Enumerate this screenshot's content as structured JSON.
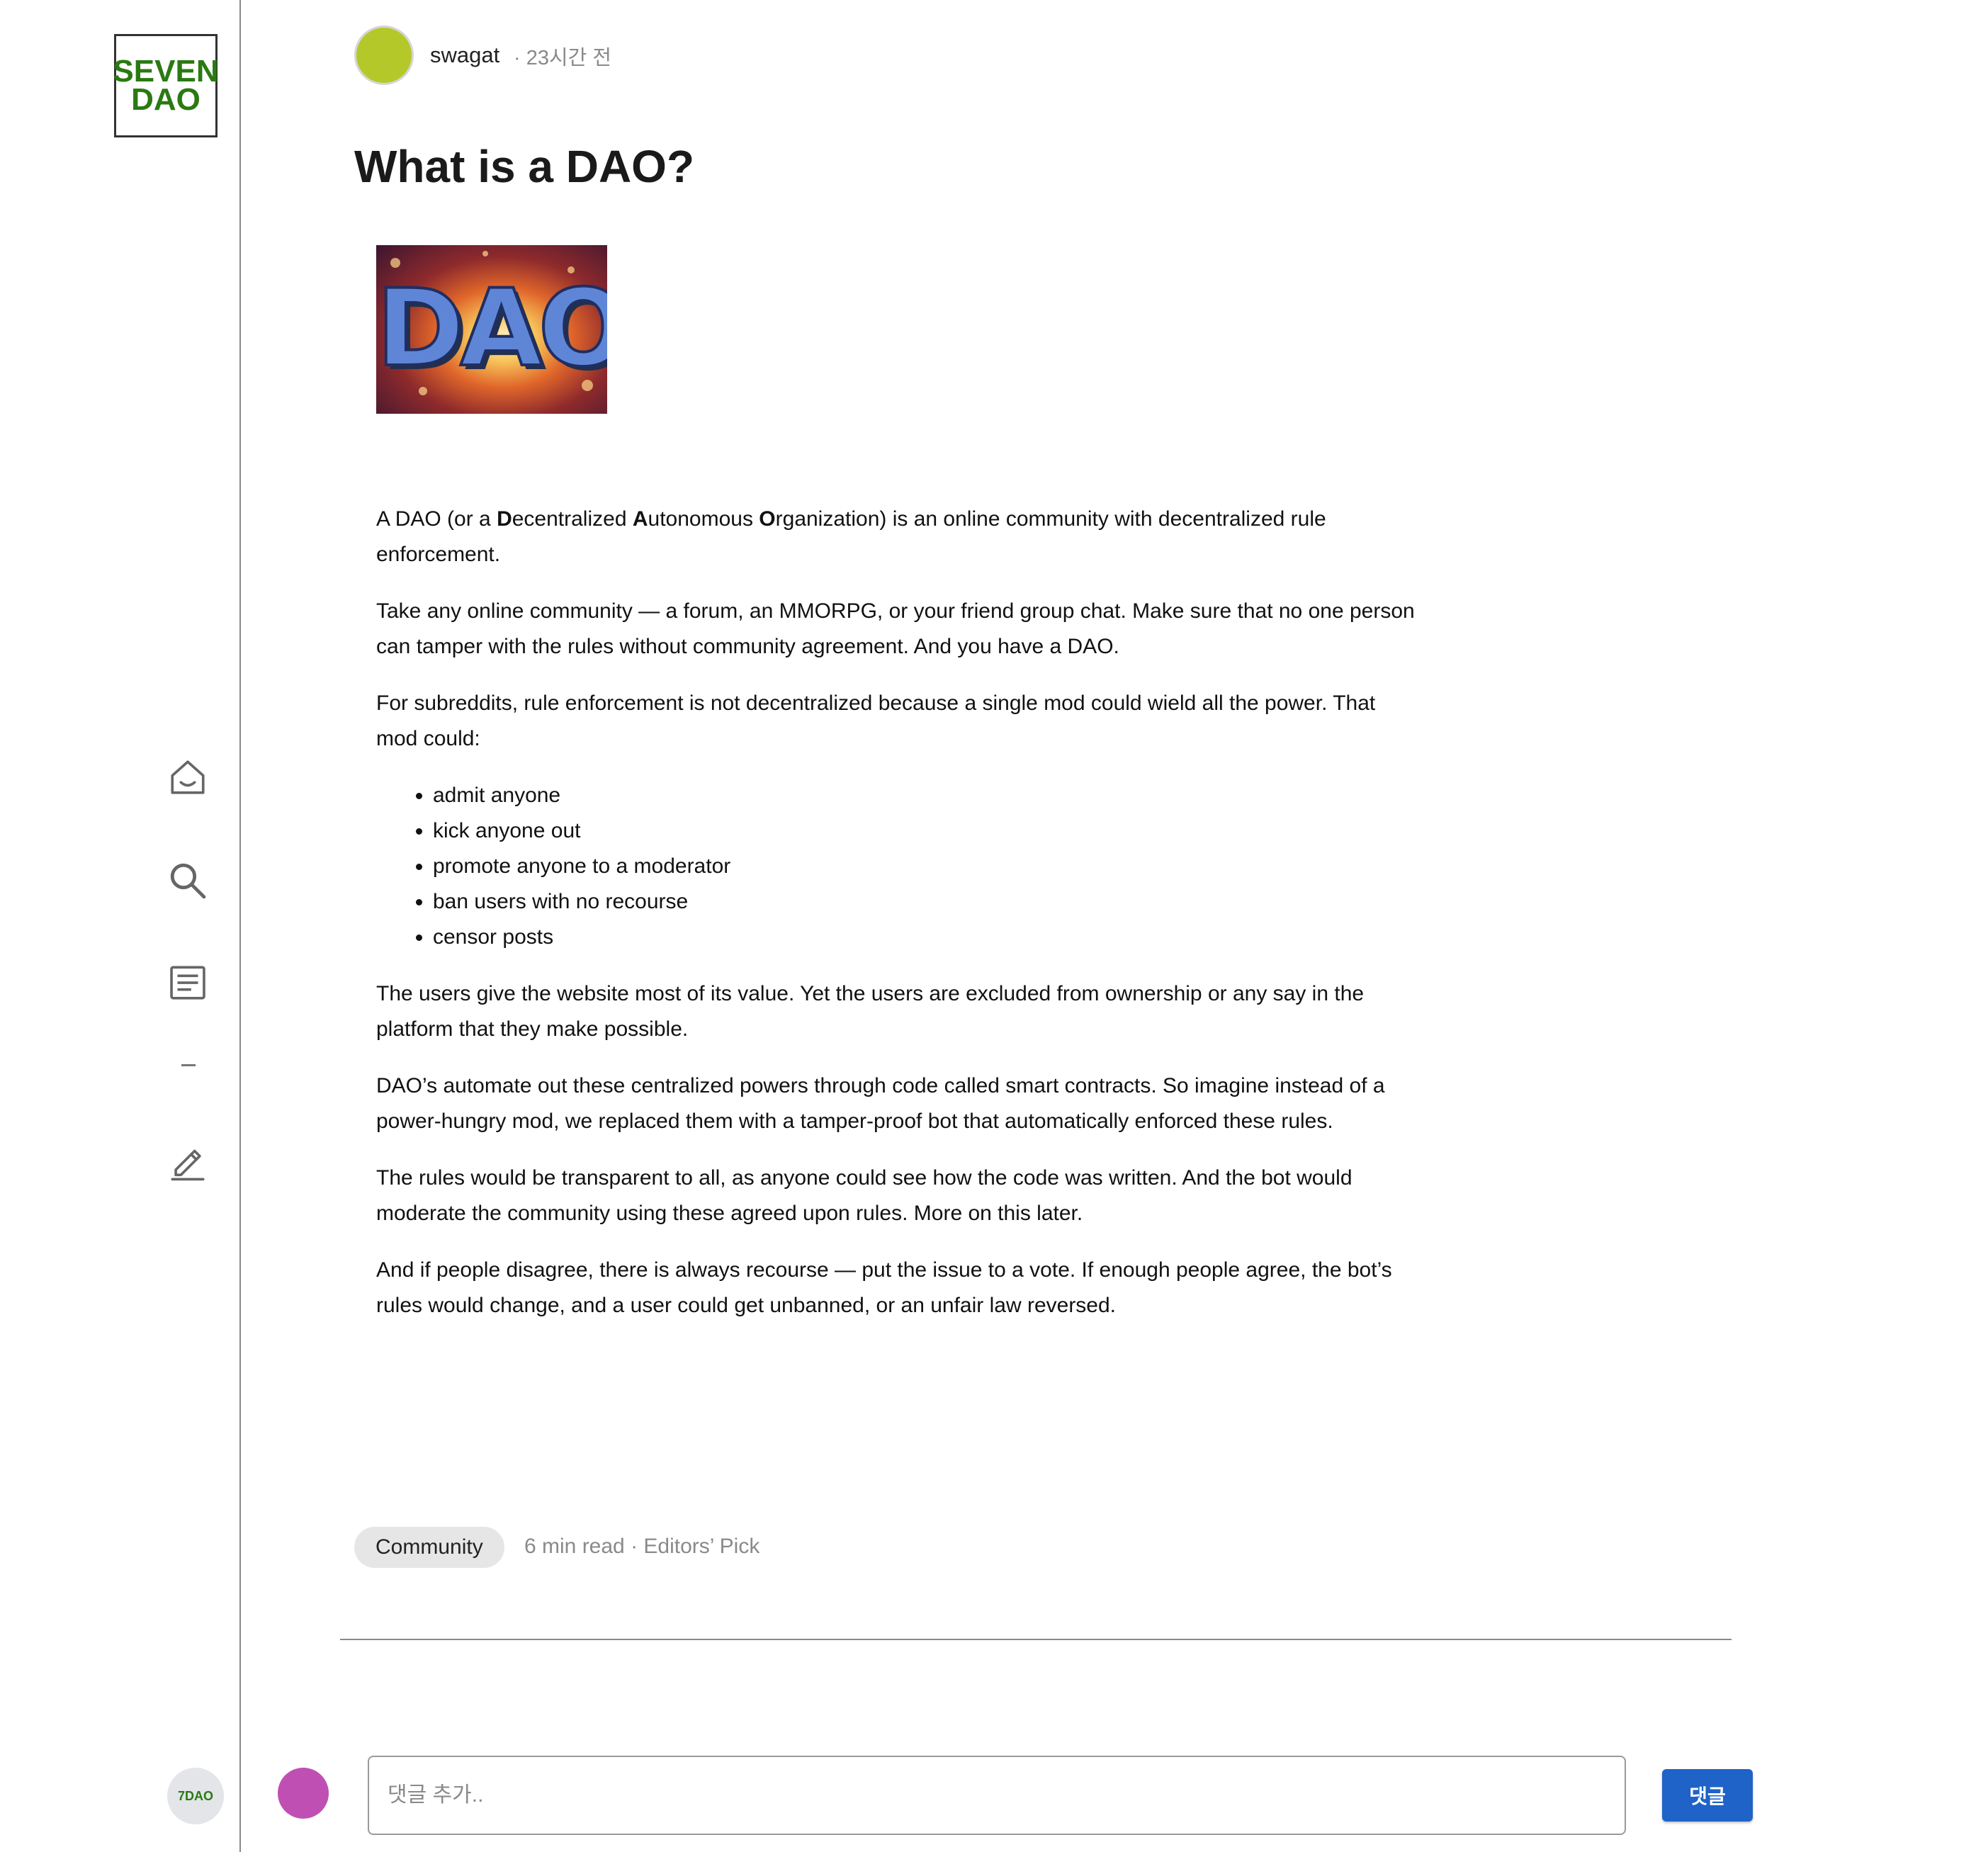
{
  "sidebar": {
    "logo": {
      "line1": "SEVEN",
      "line2": "DAO"
    },
    "nav": [
      {
        "icon": "home-icon"
      },
      {
        "icon": "search-icon"
      },
      {
        "icon": "article-icon"
      },
      {
        "icon": "minus-icon"
      },
      {
        "icon": "pencil-icon"
      }
    ],
    "brand_avatar_label": "7DAO"
  },
  "post": {
    "author": "swagat",
    "time": "· 23시간 전",
    "author_avatar_color": "#b5c82a",
    "title": "What is a DAO?",
    "hero_image_text": "DAO",
    "paragraphs": {
      "p1_a": "A DAO (or a ",
      "p1_d": "D",
      "p1_b": "ecentralized ",
      "p1_A": "A",
      "p1_c": "utonomous ",
      "p1_O": "O",
      "p1_e": "rganization) is an online community with decentralized rule enforcement.",
      "p2": "Take any online community — a forum, an MMORPG, or your friend group chat. Make sure that no one person can tamper with the rules without community agreement. And you have a DAO.",
      "p3": "For subreddits, rule enforcement is not decentralized because a single mod could wield all the power. That mod could:",
      "list": [
        "admit anyone",
        "kick anyone out",
        "promote anyone to a moderator",
        "ban users with no recourse",
        "censor posts"
      ],
      "p4": "The users give the website most of its value. Yet the users are excluded from ownership or any say in the platform that they make possible.",
      "p5": "DAO’s automate out these centralized powers through code called smart contracts. So imagine instead of a power-hungry mod, we replaced them with a tamper-proof bot that automatically enforced these rules.",
      "p6": "The rules would be transparent to all, as anyone could see how the code was written. And the bot would moderate the community using these agreed upon rules. More on this later.",
      "p7": "And if people disagree, there is always recourse — put the issue to a vote. If enough people agree, the bot’s rules would change, and a user could get unbanned, or an unfair law reversed."
    },
    "tag": "Community",
    "meta": "6 min read · Editors’ Pick"
  },
  "comment": {
    "user_avatar_color": "#c04fb4",
    "placeholder": "댓글 추가..",
    "value": "",
    "button_label": "댓글"
  },
  "colors": {
    "accent": "#1f63c8",
    "logo_green": "#2a7a12"
  }
}
